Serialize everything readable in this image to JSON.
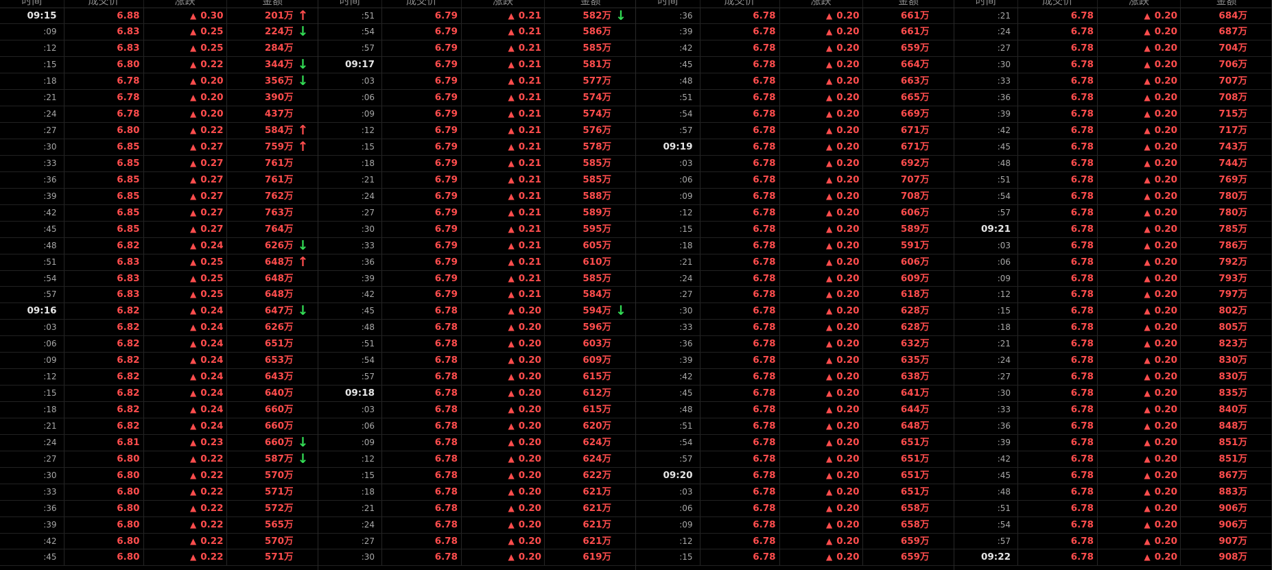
{
  "colors": {
    "background": "#000000",
    "up": "#ff4d4d",
    "down": "#33dd55",
    "header": "#8c8c8c",
    "minute": "#e6e6e6",
    "second": "#a8a8a8"
  },
  "header": {
    "time": "时间",
    "price": "成交价",
    "change": "涨跌",
    "amount": "金额"
  },
  "icons": {
    "change": "up-triangle-icon",
    "up_arrow": "up-arrow-icon",
    "down_arrow": "down-arrow-icon"
  },
  "columns": [
    {
      "rows": [
        {
          "t": "09:15",
          "p": "6.88",
          "c": "0.30",
          "a": "201万",
          "ar": "up"
        },
        {
          "t": ":09",
          "p": "6.83",
          "c": "0.25",
          "a": "224万",
          "ar": "down"
        },
        {
          "t": ":12",
          "p": "6.83",
          "c": "0.25",
          "a": "284万",
          "ar": ""
        },
        {
          "t": ":15",
          "p": "6.80",
          "c": "0.22",
          "a": "344万",
          "ar": "down"
        },
        {
          "t": ":18",
          "p": "6.78",
          "c": "0.20",
          "a": "356万",
          "ar": "down"
        },
        {
          "t": ":21",
          "p": "6.78",
          "c": "0.20",
          "a": "390万",
          "ar": ""
        },
        {
          "t": ":24",
          "p": "6.78",
          "c": "0.20",
          "a": "437万",
          "ar": ""
        },
        {
          "t": ":27",
          "p": "6.80",
          "c": "0.22",
          "a": "584万",
          "ar": "up"
        },
        {
          "t": ":30",
          "p": "6.85",
          "c": "0.27",
          "a": "759万",
          "ar": "up"
        },
        {
          "t": ":33",
          "p": "6.85",
          "c": "0.27",
          "a": "761万",
          "ar": ""
        },
        {
          "t": ":36",
          "p": "6.85",
          "c": "0.27",
          "a": "761万",
          "ar": ""
        },
        {
          "t": ":39",
          "p": "6.85",
          "c": "0.27",
          "a": "762万",
          "ar": ""
        },
        {
          "t": ":42",
          "p": "6.85",
          "c": "0.27",
          "a": "763万",
          "ar": ""
        },
        {
          "t": ":45",
          "p": "6.85",
          "c": "0.27",
          "a": "764万",
          "ar": ""
        },
        {
          "t": ":48",
          "p": "6.82",
          "c": "0.24",
          "a": "626万",
          "ar": "down"
        },
        {
          "t": ":51",
          "p": "6.83",
          "c": "0.25",
          "a": "648万",
          "ar": "up"
        },
        {
          "t": ":54",
          "p": "6.83",
          "c": "0.25",
          "a": "648万",
          "ar": ""
        },
        {
          "t": ":57",
          "p": "6.83",
          "c": "0.25",
          "a": "648万",
          "ar": ""
        },
        {
          "t": "09:16",
          "p": "6.82",
          "c": "0.24",
          "a": "647万",
          "ar": "down"
        },
        {
          "t": ":03",
          "p": "6.82",
          "c": "0.24",
          "a": "626万",
          "ar": ""
        },
        {
          "t": ":06",
          "p": "6.82",
          "c": "0.24",
          "a": "651万",
          "ar": ""
        },
        {
          "t": ":09",
          "p": "6.82",
          "c": "0.24",
          "a": "653万",
          "ar": ""
        },
        {
          "t": ":12",
          "p": "6.82",
          "c": "0.24",
          "a": "643万",
          "ar": ""
        },
        {
          "t": ":15",
          "p": "6.82",
          "c": "0.24",
          "a": "640万",
          "ar": ""
        },
        {
          "t": ":18",
          "p": "6.82",
          "c": "0.24",
          "a": "660万",
          "ar": ""
        },
        {
          "t": ":21",
          "p": "6.82",
          "c": "0.24",
          "a": "660万",
          "ar": ""
        },
        {
          "t": ":24",
          "p": "6.81",
          "c": "0.23",
          "a": "660万",
          "ar": "down"
        },
        {
          "t": ":27",
          "p": "6.80",
          "c": "0.22",
          "a": "587万",
          "ar": "down"
        },
        {
          "t": ":30",
          "p": "6.80",
          "c": "0.22",
          "a": "570万",
          "ar": ""
        },
        {
          "t": ":33",
          "p": "6.80",
          "c": "0.22",
          "a": "571万",
          "ar": ""
        },
        {
          "t": ":36",
          "p": "6.80",
          "c": "0.22",
          "a": "572万",
          "ar": ""
        },
        {
          "t": ":39",
          "p": "6.80",
          "c": "0.22",
          "a": "565万",
          "ar": ""
        },
        {
          "t": ":42",
          "p": "6.80",
          "c": "0.22",
          "a": "570万",
          "ar": ""
        },
        {
          "t": ":45",
          "p": "6.80",
          "c": "0.22",
          "a": "571万",
          "ar": ""
        }
      ]
    },
    {
      "rows": [
        {
          "t": ":51",
          "p": "6.79",
          "c": "0.21",
          "a": "582万",
          "ar": "down"
        },
        {
          "t": ":54",
          "p": "6.79",
          "c": "0.21",
          "a": "586万",
          "ar": ""
        },
        {
          "t": ":57",
          "p": "6.79",
          "c": "0.21",
          "a": "585万",
          "ar": ""
        },
        {
          "t": "09:17",
          "p": "6.79",
          "c": "0.21",
          "a": "581万",
          "ar": ""
        },
        {
          "t": ":03",
          "p": "6.79",
          "c": "0.21",
          "a": "577万",
          "ar": ""
        },
        {
          "t": ":06",
          "p": "6.79",
          "c": "0.21",
          "a": "574万",
          "ar": ""
        },
        {
          "t": ":09",
          "p": "6.79",
          "c": "0.21",
          "a": "574万",
          "ar": ""
        },
        {
          "t": ":12",
          "p": "6.79",
          "c": "0.21",
          "a": "576万",
          "ar": ""
        },
        {
          "t": ":15",
          "p": "6.79",
          "c": "0.21",
          "a": "578万",
          "ar": ""
        },
        {
          "t": ":18",
          "p": "6.79",
          "c": "0.21",
          "a": "585万",
          "ar": ""
        },
        {
          "t": ":21",
          "p": "6.79",
          "c": "0.21",
          "a": "585万",
          "ar": ""
        },
        {
          "t": ":24",
          "p": "6.79",
          "c": "0.21",
          "a": "588万",
          "ar": ""
        },
        {
          "t": ":27",
          "p": "6.79",
          "c": "0.21",
          "a": "589万",
          "ar": ""
        },
        {
          "t": ":30",
          "p": "6.79",
          "c": "0.21",
          "a": "595万",
          "ar": ""
        },
        {
          "t": ":33",
          "p": "6.79",
          "c": "0.21",
          "a": "605万",
          "ar": ""
        },
        {
          "t": ":36",
          "p": "6.79",
          "c": "0.21",
          "a": "610万",
          "ar": ""
        },
        {
          "t": ":39",
          "p": "6.79",
          "c": "0.21",
          "a": "585万",
          "ar": ""
        },
        {
          "t": ":42",
          "p": "6.79",
          "c": "0.21",
          "a": "584万",
          "ar": ""
        },
        {
          "t": ":45",
          "p": "6.78",
          "c": "0.20",
          "a": "594万",
          "ar": "down"
        },
        {
          "t": ":48",
          "p": "6.78",
          "c": "0.20",
          "a": "596万",
          "ar": ""
        },
        {
          "t": ":51",
          "p": "6.78",
          "c": "0.20",
          "a": "603万",
          "ar": ""
        },
        {
          "t": ":54",
          "p": "6.78",
          "c": "0.20",
          "a": "609万",
          "ar": ""
        },
        {
          "t": ":57",
          "p": "6.78",
          "c": "0.20",
          "a": "615万",
          "ar": ""
        },
        {
          "t": "09:18",
          "p": "6.78",
          "c": "0.20",
          "a": "612万",
          "ar": ""
        },
        {
          "t": ":03",
          "p": "6.78",
          "c": "0.20",
          "a": "615万",
          "ar": ""
        },
        {
          "t": ":06",
          "p": "6.78",
          "c": "0.20",
          "a": "620万",
          "ar": ""
        },
        {
          "t": ":09",
          "p": "6.78",
          "c": "0.20",
          "a": "624万",
          "ar": ""
        },
        {
          "t": ":12",
          "p": "6.78",
          "c": "0.20",
          "a": "624万",
          "ar": ""
        },
        {
          "t": ":15",
          "p": "6.78",
          "c": "0.20",
          "a": "622万",
          "ar": ""
        },
        {
          "t": ":18",
          "p": "6.78",
          "c": "0.20",
          "a": "621万",
          "ar": ""
        },
        {
          "t": ":21",
          "p": "6.78",
          "c": "0.20",
          "a": "621万",
          "ar": ""
        },
        {
          "t": ":24",
          "p": "6.78",
          "c": "0.20",
          "a": "621万",
          "ar": ""
        },
        {
          "t": ":27",
          "p": "6.78",
          "c": "0.20",
          "a": "621万",
          "ar": ""
        },
        {
          "t": ":30",
          "p": "6.78",
          "c": "0.20",
          "a": "619万",
          "ar": ""
        }
      ]
    },
    {
      "rows": [
        {
          "t": ":36",
          "p": "6.78",
          "c": "0.20",
          "a": "661万",
          "ar": ""
        },
        {
          "t": ":39",
          "p": "6.78",
          "c": "0.20",
          "a": "661万",
          "ar": ""
        },
        {
          "t": ":42",
          "p": "6.78",
          "c": "0.20",
          "a": "659万",
          "ar": ""
        },
        {
          "t": ":45",
          "p": "6.78",
          "c": "0.20",
          "a": "664万",
          "ar": ""
        },
        {
          "t": ":48",
          "p": "6.78",
          "c": "0.20",
          "a": "663万",
          "ar": ""
        },
        {
          "t": ":51",
          "p": "6.78",
          "c": "0.20",
          "a": "665万",
          "ar": ""
        },
        {
          "t": ":54",
          "p": "6.78",
          "c": "0.20",
          "a": "669万",
          "ar": ""
        },
        {
          "t": ":57",
          "p": "6.78",
          "c": "0.20",
          "a": "671万",
          "ar": ""
        },
        {
          "t": "09:19",
          "p": "6.78",
          "c": "0.20",
          "a": "671万",
          "ar": ""
        },
        {
          "t": ":03",
          "p": "6.78",
          "c": "0.20",
          "a": "692万",
          "ar": ""
        },
        {
          "t": ":06",
          "p": "6.78",
          "c": "0.20",
          "a": "707万",
          "ar": ""
        },
        {
          "t": ":09",
          "p": "6.78",
          "c": "0.20",
          "a": "708万",
          "ar": ""
        },
        {
          "t": ":12",
          "p": "6.78",
          "c": "0.20",
          "a": "606万",
          "ar": ""
        },
        {
          "t": ":15",
          "p": "6.78",
          "c": "0.20",
          "a": "589万",
          "ar": ""
        },
        {
          "t": ":18",
          "p": "6.78",
          "c": "0.20",
          "a": "591万",
          "ar": ""
        },
        {
          "t": ":21",
          "p": "6.78",
          "c": "0.20",
          "a": "606万",
          "ar": ""
        },
        {
          "t": ":24",
          "p": "6.78",
          "c": "0.20",
          "a": "609万",
          "ar": ""
        },
        {
          "t": ":27",
          "p": "6.78",
          "c": "0.20",
          "a": "618万",
          "ar": ""
        },
        {
          "t": ":30",
          "p": "6.78",
          "c": "0.20",
          "a": "628万",
          "ar": ""
        },
        {
          "t": ":33",
          "p": "6.78",
          "c": "0.20",
          "a": "628万",
          "ar": ""
        },
        {
          "t": ":36",
          "p": "6.78",
          "c": "0.20",
          "a": "632万",
          "ar": ""
        },
        {
          "t": ":39",
          "p": "6.78",
          "c": "0.20",
          "a": "635万",
          "ar": ""
        },
        {
          "t": ":42",
          "p": "6.78",
          "c": "0.20",
          "a": "638万",
          "ar": ""
        },
        {
          "t": ":45",
          "p": "6.78",
          "c": "0.20",
          "a": "641万",
          "ar": ""
        },
        {
          "t": ":48",
          "p": "6.78",
          "c": "0.20",
          "a": "644万",
          "ar": ""
        },
        {
          "t": ":51",
          "p": "6.78",
          "c": "0.20",
          "a": "648万",
          "ar": ""
        },
        {
          "t": ":54",
          "p": "6.78",
          "c": "0.20",
          "a": "651万",
          "ar": ""
        },
        {
          "t": ":57",
          "p": "6.78",
          "c": "0.20",
          "a": "651万",
          "ar": ""
        },
        {
          "t": "09:20",
          "p": "6.78",
          "c": "0.20",
          "a": "651万",
          "ar": ""
        },
        {
          "t": ":03",
          "p": "6.78",
          "c": "0.20",
          "a": "651万",
          "ar": ""
        },
        {
          "t": ":06",
          "p": "6.78",
          "c": "0.20",
          "a": "658万",
          "ar": ""
        },
        {
          "t": ":09",
          "p": "6.78",
          "c": "0.20",
          "a": "658万",
          "ar": ""
        },
        {
          "t": ":12",
          "p": "6.78",
          "c": "0.20",
          "a": "659万",
          "ar": ""
        },
        {
          "t": ":15",
          "p": "6.78",
          "c": "0.20",
          "a": "659万",
          "ar": ""
        }
      ]
    },
    {
      "rows": [
        {
          "t": ":21",
          "p": "6.78",
          "c": "0.20",
          "a": "684万",
          "ar": ""
        },
        {
          "t": ":24",
          "p": "6.78",
          "c": "0.20",
          "a": "687万",
          "ar": ""
        },
        {
          "t": ":27",
          "p": "6.78",
          "c": "0.20",
          "a": "704万",
          "ar": ""
        },
        {
          "t": ":30",
          "p": "6.78",
          "c": "0.20",
          "a": "706万",
          "ar": ""
        },
        {
          "t": ":33",
          "p": "6.78",
          "c": "0.20",
          "a": "707万",
          "ar": ""
        },
        {
          "t": ":36",
          "p": "6.78",
          "c": "0.20",
          "a": "708万",
          "ar": ""
        },
        {
          "t": ":39",
          "p": "6.78",
          "c": "0.20",
          "a": "715万",
          "ar": ""
        },
        {
          "t": ":42",
          "p": "6.78",
          "c": "0.20",
          "a": "717万",
          "ar": ""
        },
        {
          "t": ":45",
          "p": "6.78",
          "c": "0.20",
          "a": "743万",
          "ar": ""
        },
        {
          "t": ":48",
          "p": "6.78",
          "c": "0.20",
          "a": "744万",
          "ar": ""
        },
        {
          "t": ":51",
          "p": "6.78",
          "c": "0.20",
          "a": "769万",
          "ar": ""
        },
        {
          "t": ":54",
          "p": "6.78",
          "c": "0.20",
          "a": "780万",
          "ar": ""
        },
        {
          "t": ":57",
          "p": "6.78",
          "c": "0.20",
          "a": "780万",
          "ar": ""
        },
        {
          "t": "09:21",
          "p": "6.78",
          "c": "0.20",
          "a": "785万",
          "ar": ""
        },
        {
          "t": ":03",
          "p": "6.78",
          "c": "0.20",
          "a": "786万",
          "ar": ""
        },
        {
          "t": ":06",
          "p": "6.78",
          "c": "0.20",
          "a": "792万",
          "ar": ""
        },
        {
          "t": ":09",
          "p": "6.78",
          "c": "0.20",
          "a": "793万",
          "ar": ""
        },
        {
          "t": ":12",
          "p": "6.78",
          "c": "0.20",
          "a": "797万",
          "ar": ""
        },
        {
          "t": ":15",
          "p": "6.78",
          "c": "0.20",
          "a": "802万",
          "ar": ""
        },
        {
          "t": ":18",
          "p": "6.78",
          "c": "0.20",
          "a": "805万",
          "ar": ""
        },
        {
          "t": ":21",
          "p": "6.78",
          "c": "0.20",
          "a": "823万",
          "ar": ""
        },
        {
          "t": ":24",
          "p": "6.78",
          "c": "0.20",
          "a": "830万",
          "ar": ""
        },
        {
          "t": ":27",
          "p": "6.78",
          "c": "0.20",
          "a": "830万",
          "ar": ""
        },
        {
          "t": ":30",
          "p": "6.78",
          "c": "0.20",
          "a": "835万",
          "ar": ""
        },
        {
          "t": ":33",
          "p": "6.78",
          "c": "0.20",
          "a": "840万",
          "ar": ""
        },
        {
          "t": ":36",
          "p": "6.78",
          "c": "0.20",
          "a": "848万",
          "ar": ""
        },
        {
          "t": ":39",
          "p": "6.78",
          "c": "0.20",
          "a": "851万",
          "ar": ""
        },
        {
          "t": ":42",
          "p": "6.78",
          "c": "0.20",
          "a": "851万",
          "ar": ""
        },
        {
          "t": ":45",
          "p": "6.78",
          "c": "0.20",
          "a": "867万",
          "ar": ""
        },
        {
          "t": ":48",
          "p": "6.78",
          "c": "0.20",
          "a": "883万",
          "ar": ""
        },
        {
          "t": ":51",
          "p": "6.78",
          "c": "0.20",
          "a": "906万",
          "ar": ""
        },
        {
          "t": ":54",
          "p": "6.78",
          "c": "0.20",
          "a": "906万",
          "ar": ""
        },
        {
          "t": ":57",
          "p": "6.78",
          "c": "0.20",
          "a": "907万",
          "ar": ""
        },
        {
          "t": "09:22",
          "p": "6.78",
          "c": "0.20",
          "a": "908万",
          "ar": ""
        }
      ]
    }
  ]
}
